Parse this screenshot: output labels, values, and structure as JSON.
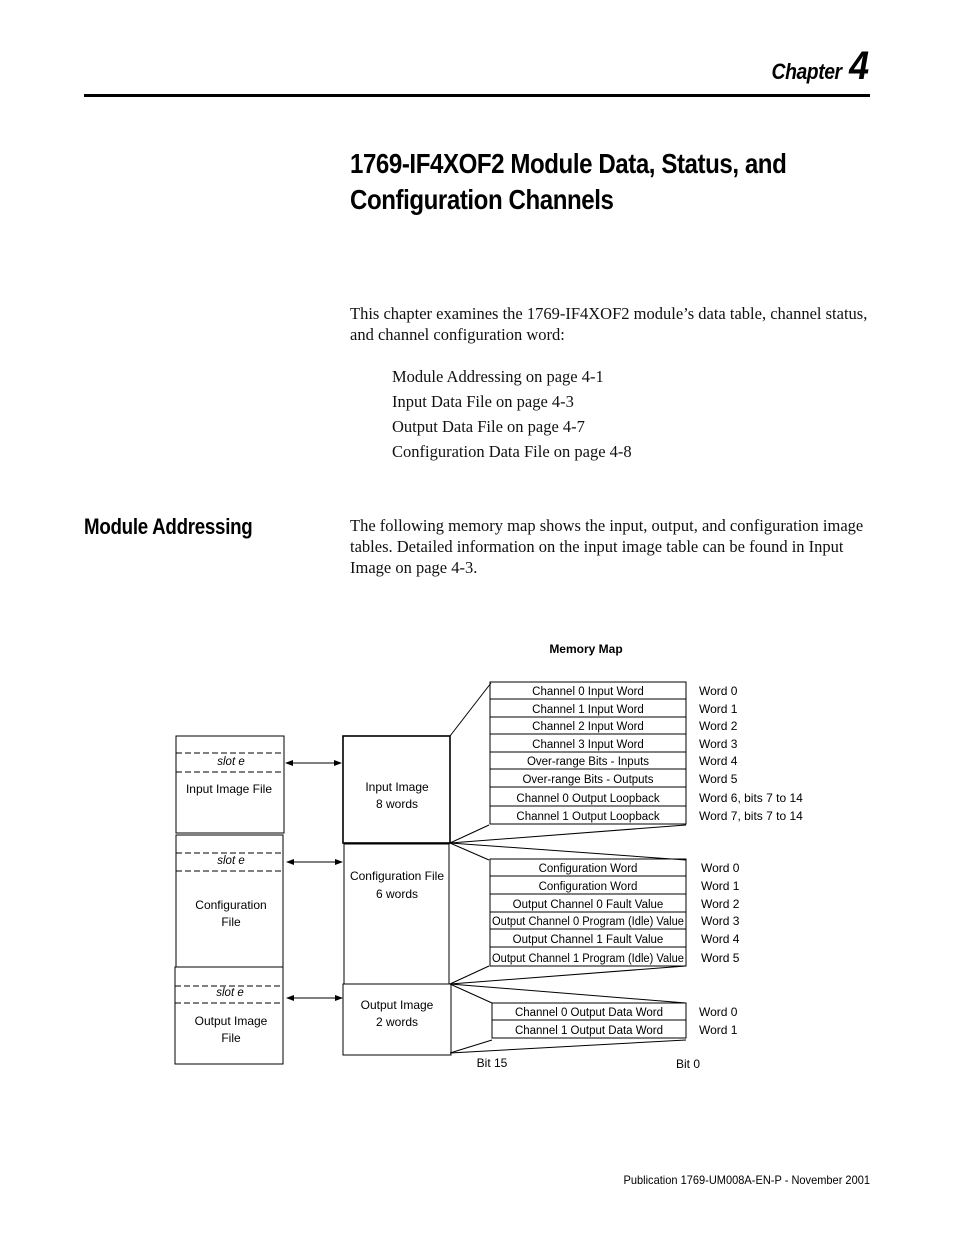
{
  "header": {
    "chapter_label": "Chapter",
    "chapter_number": "4"
  },
  "title": {
    "line1": "1769-IF4XOF2 Module Data, Status, and",
    "line2": "Configuration Channels"
  },
  "intro": {
    "paragraph": "This chapter examines the 1769-IF4XOF2 module’s data table, channel status, and channel configuration word:",
    "toc": [
      "Module Addressing on page 4-1",
      "Input Data File on page 4-3",
      "Output Data File on page 4-7",
      "Configuration Data File on page 4-8"
    ]
  },
  "section": {
    "heading": "Module Addressing",
    "paragraph": "The following memory map shows the input, output, and configuration image tables. Detailed information on the input image table can be found in Input Image on page 4-3."
  },
  "memory_map": {
    "title": "Memory Map",
    "left_files": [
      {
        "slot": "slot e",
        "label_lines": [
          "Input Image File"
        ]
      },
      {
        "slot": "slot e",
        "label_lines": [
          "Configuration",
          "File"
        ]
      },
      {
        "slot": "slot e",
        "label_lines": [
          "Output Image",
          "File"
        ]
      }
    ],
    "middle_blocks": [
      {
        "label_lines": [
          "Input Image",
          "8 words"
        ]
      },
      {
        "label_lines": [
          "Configuration File",
          "6 words"
        ]
      },
      {
        "label_lines": [
          "Output Image",
          "2 words"
        ]
      }
    ],
    "input_words": [
      {
        "name": "Channel 0 Input Word",
        "word": "Word 0"
      },
      {
        "name": "Channel 1 Input Word",
        "word": "Word 1"
      },
      {
        "name": "Channel 2 Input Word",
        "word": "Word 2"
      },
      {
        "name": "Channel 3 Input Word",
        "word": "Word 3"
      },
      {
        "name": "Over-range Bits - Inputs",
        "word": "Word 4"
      },
      {
        "name": "Over-range Bits - Outputs",
        "word": "Word 5"
      },
      {
        "name": "Channel 0 Output Loopback",
        "word": "Word 6, bits 7 to 14"
      },
      {
        "name": "Channel 1 Output Loopback",
        "word": "Word 7, bits 7 to 14"
      }
    ],
    "config_words": [
      {
        "name": "Configuration Word",
        "word": "Word 0"
      },
      {
        "name": "Configuration Word",
        "word": "Word 1"
      },
      {
        "name": "Output Channel 0 Fault Value",
        "word": "Word 2"
      },
      {
        "name": "Output Channel 0 Program (Idle) Value",
        "word": "Word 3"
      },
      {
        "name": "Output Channel 1 Fault Value",
        "word": "Word 4"
      },
      {
        "name": "Output Channel 1 Program (Idle) Value",
        "word": "Word 5"
      }
    ],
    "output_words": [
      {
        "name": "Channel 0 Output Data Word",
        "word": "Word 0"
      },
      {
        "name": "Channel 1 Output Data Word",
        "word": "Word 1"
      }
    ],
    "bit_labels": {
      "msb": "Bit 15",
      "lsb": "Bit 0"
    }
  },
  "footer": {
    "publication": "Publication 1769-UM008A-EN-P - November 2001"
  }
}
